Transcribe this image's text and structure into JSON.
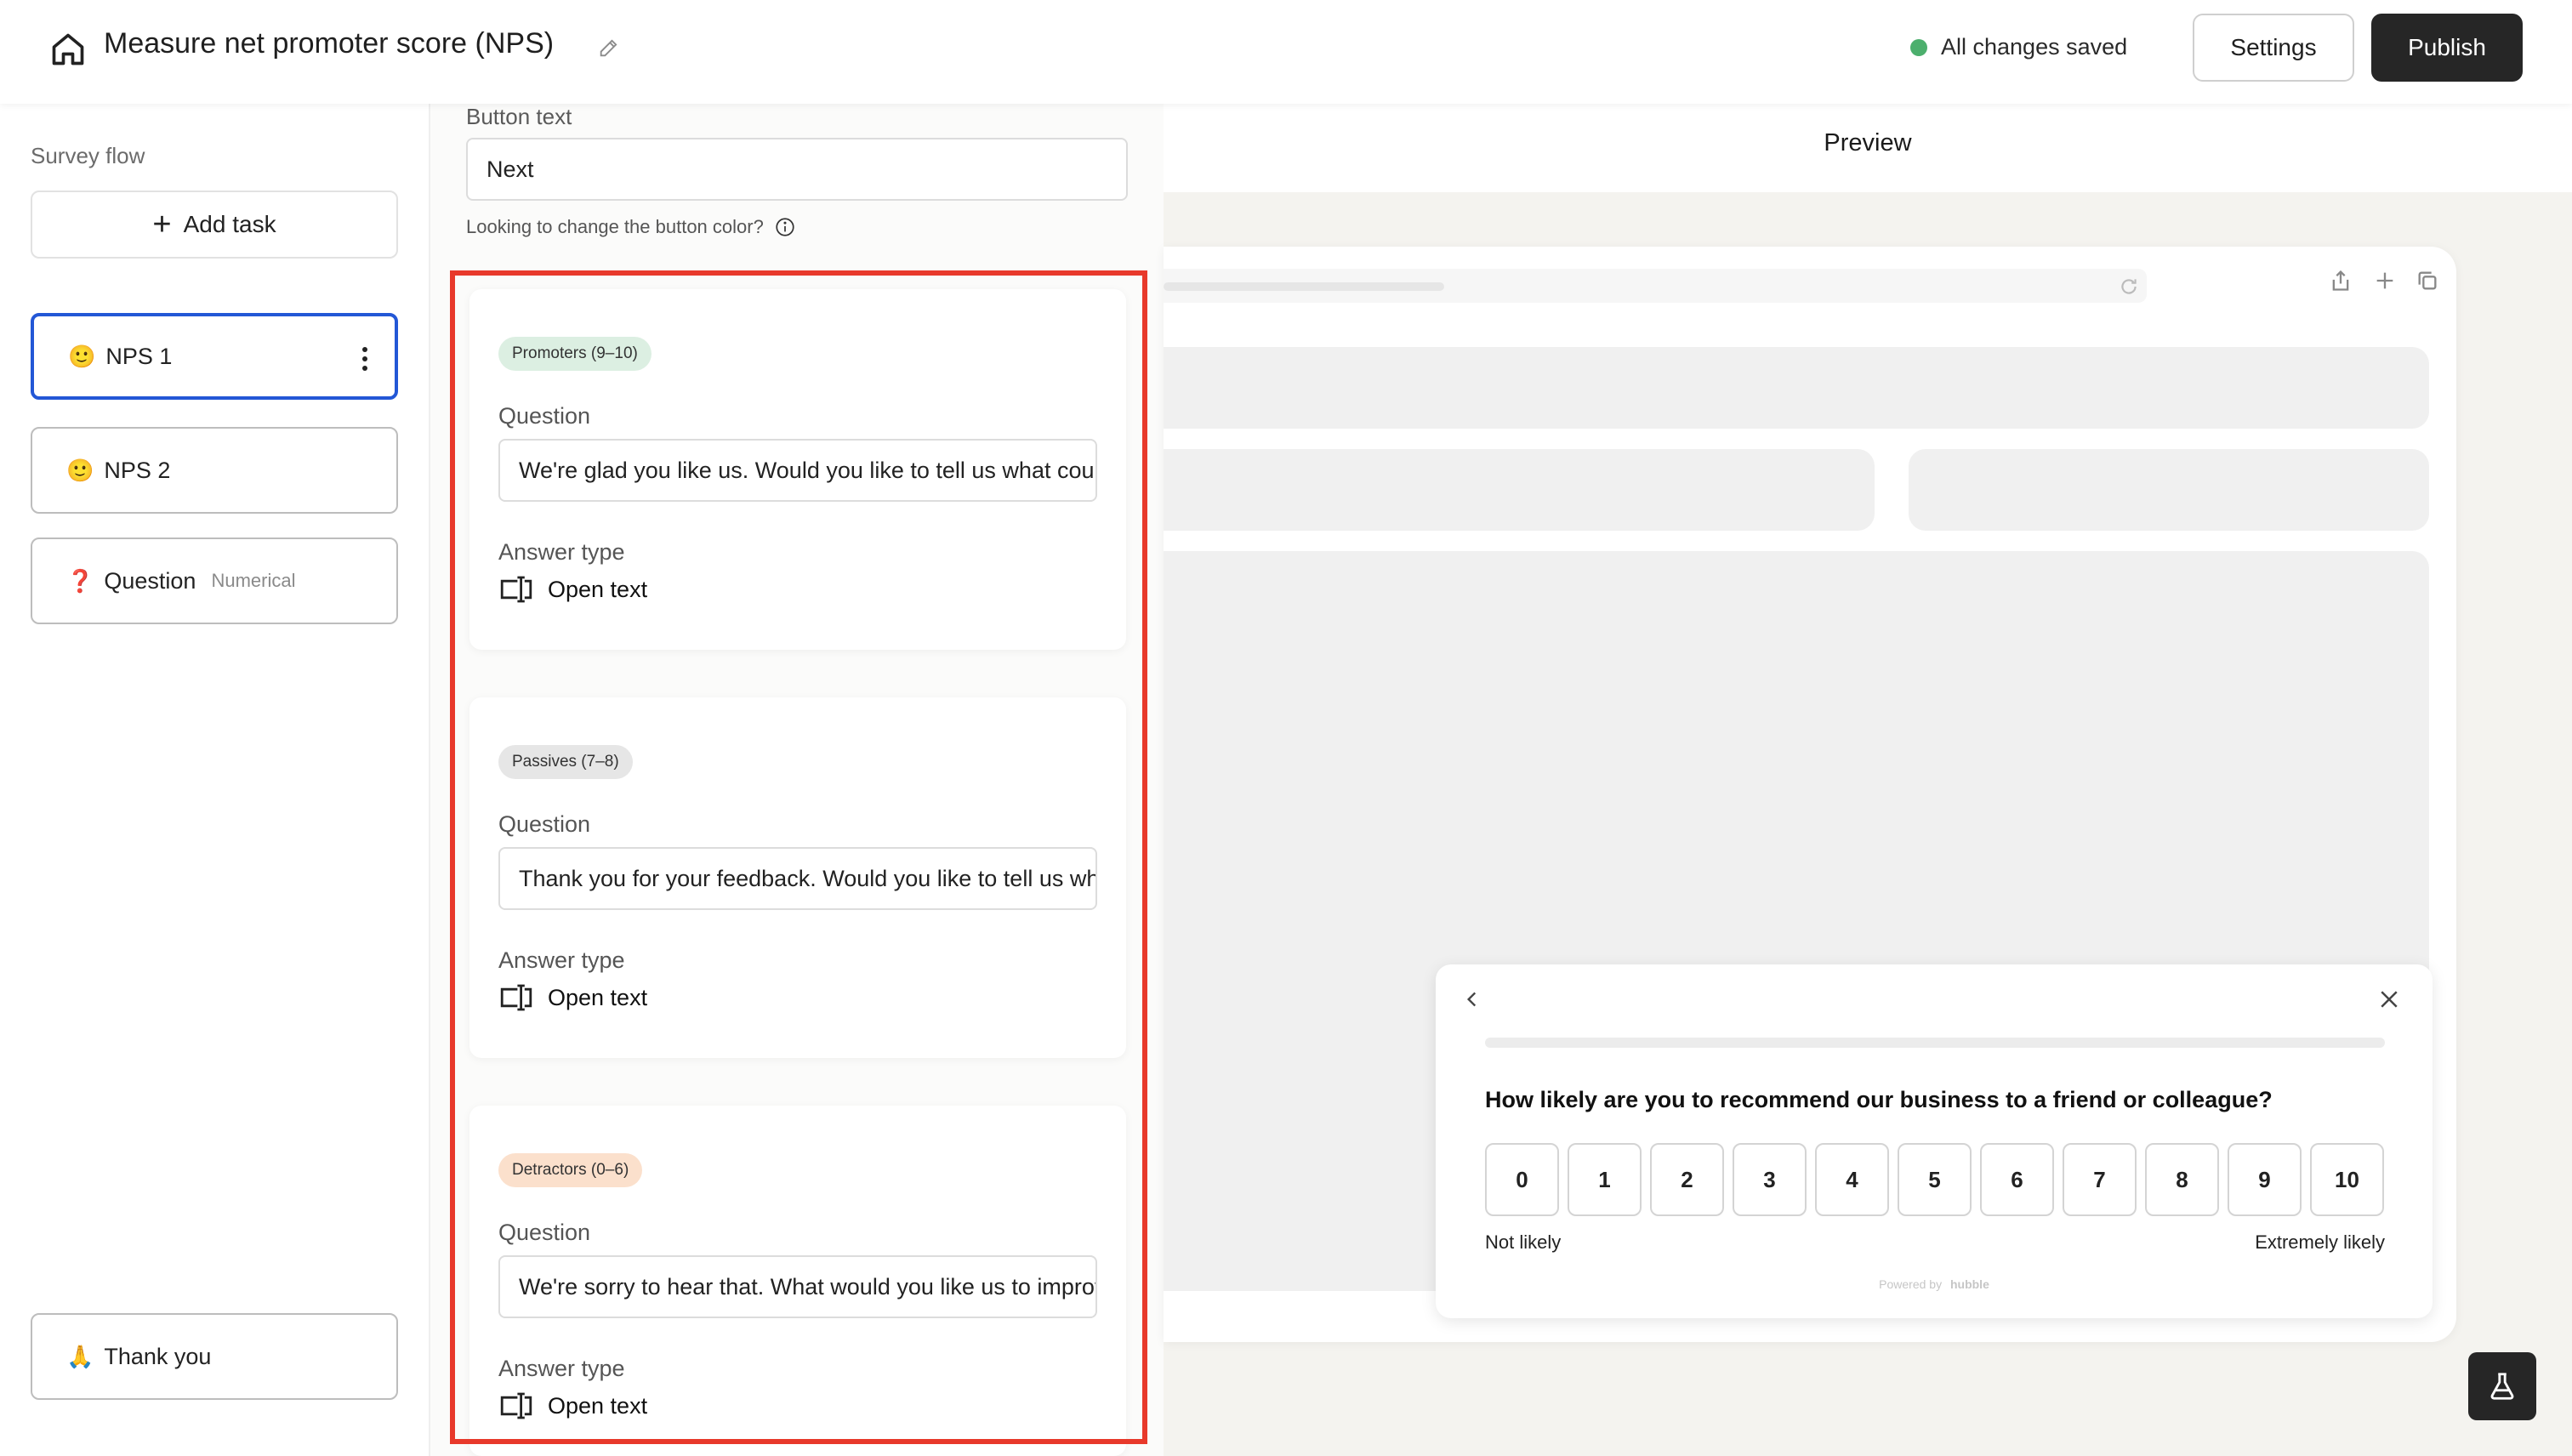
{
  "header": {
    "title": "Measure net promoter score (NPS)",
    "save_status": "All changes saved",
    "settings_label": "Settings",
    "publish_label": "Publish",
    "status_color": "#4caf6d"
  },
  "sidebar": {
    "heading": "Survey flow",
    "add_task_label": "Add task",
    "items": [
      {
        "emoji": "🙂",
        "label": "NPS 1",
        "active": true
      },
      {
        "emoji": "🙂",
        "label": "NPS 2"
      },
      {
        "emoji": "❓",
        "label": "Question",
        "secondary": "Numerical"
      },
      {
        "emoji": "🙏",
        "label": "Thank you"
      }
    ]
  },
  "panel": {
    "button_text_label": "Button text",
    "button_text_value": "Next",
    "hint": "Looking to change the button color?",
    "cards": [
      {
        "badge": "Promoters (9–10)",
        "badge_color": "#dcefe2",
        "question_label": "Question",
        "question_value": "We're glad you like us. Would you like to tell us what could make it even better?",
        "answer_type_label": "Answer type",
        "answer_type_value": "Open text"
      },
      {
        "badge": "Passives (7–8)",
        "badge_color": "#e6e6e6",
        "question_label": "Question",
        "question_value": "Thank you for your feedback. Would you like to tell us what we could improve?",
        "answer_type_label": "Answer type",
        "answer_type_value": "Open text"
      },
      {
        "badge": "Detractors (0–6)",
        "badge_color": "#fbe0cc",
        "question_label": "Question",
        "question_value": "We're sorry to hear that. What would you like us to improve?",
        "answer_type_label": "Answer type",
        "answer_type_value": "Open text"
      }
    ],
    "highlight_color": "#e8392b"
  },
  "preview": {
    "title": "Preview",
    "widget": {
      "question": "How likely are you to recommend our business to a friend or colleague?",
      "scale": [
        "0",
        "1",
        "2",
        "3",
        "4",
        "5",
        "6",
        "7",
        "8",
        "9",
        "10"
      ],
      "low_label": "Not likely",
      "high_label": "Extremely likely",
      "powered_by": "Powered by",
      "brand": "hubble"
    }
  }
}
